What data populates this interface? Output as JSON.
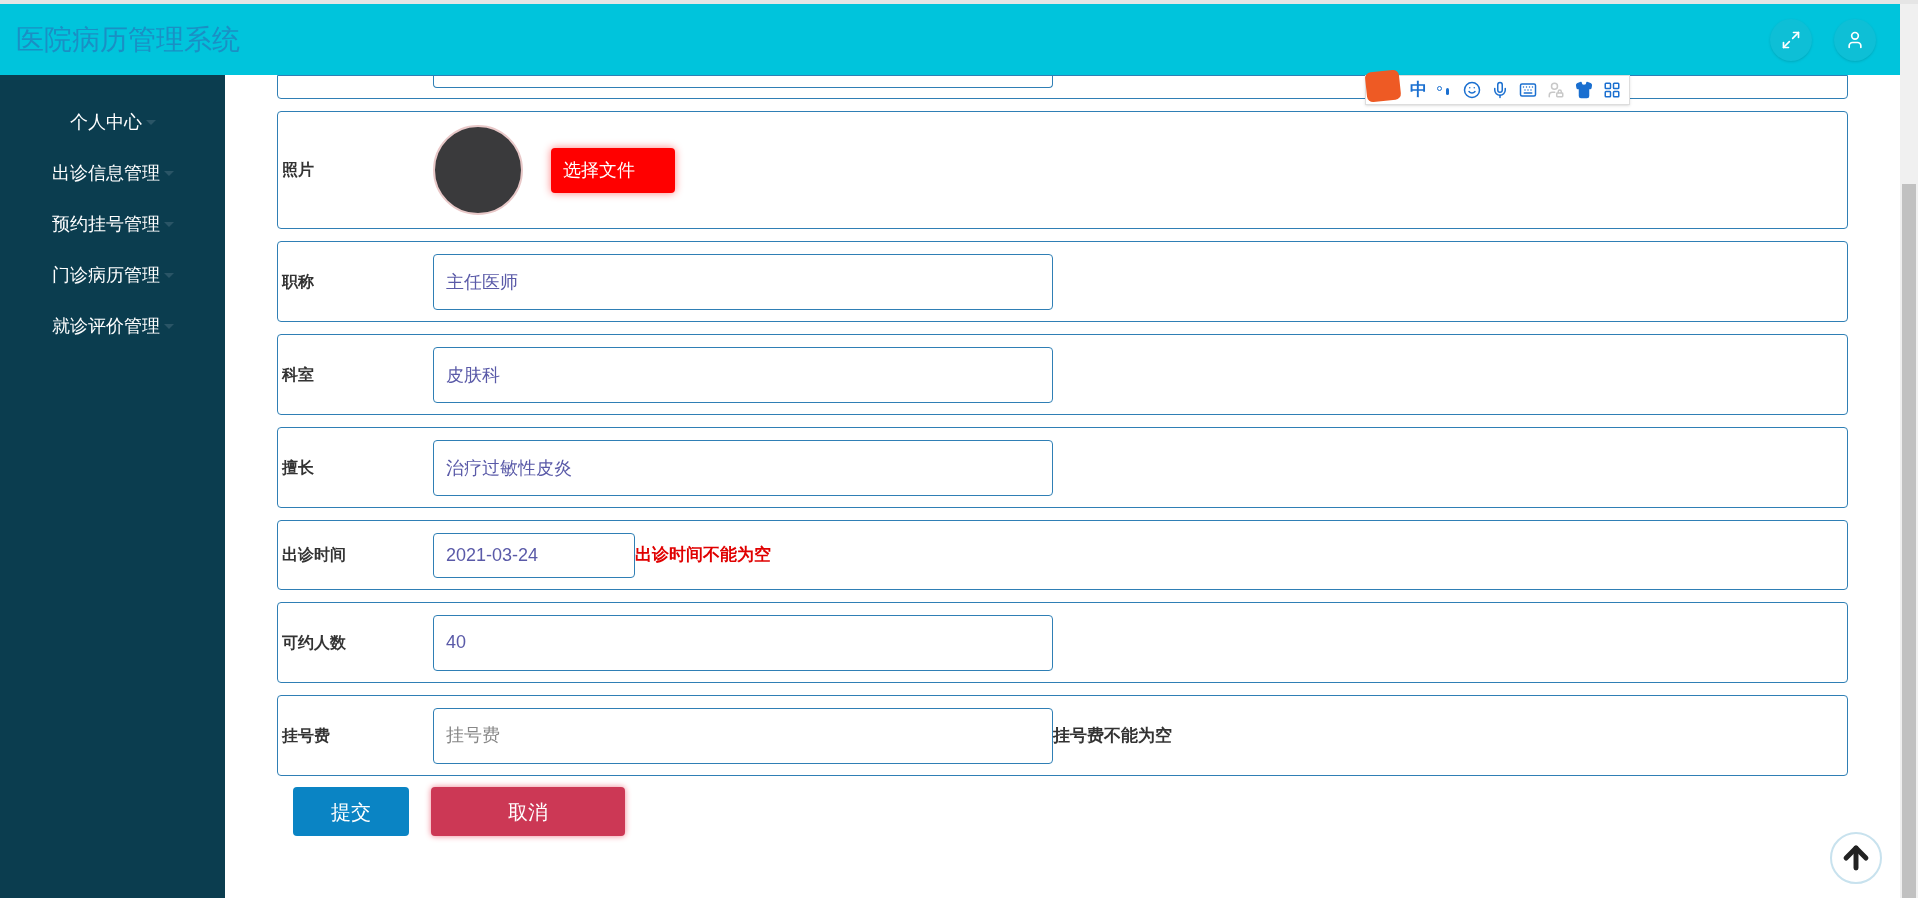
{
  "header": {
    "title": "医院病历管理系统"
  },
  "sidebar": {
    "items": [
      {
        "label": "个人中心"
      },
      {
        "label": "出诊信息管理"
      },
      {
        "label": "预约挂号管理"
      },
      {
        "label": "门诊病历管理"
      },
      {
        "label": "就诊评价管理"
      }
    ]
  },
  "ime_toolbar": {
    "mode": "中"
  },
  "form": {
    "fields": [
      {
        "kind": "partial"
      },
      {
        "kind": "photo",
        "label": "照片",
        "button": "选择文件"
      },
      {
        "kind": "text",
        "label": "职称",
        "value": "主任医师"
      },
      {
        "kind": "text",
        "label": "科室",
        "value": "皮肤科"
      },
      {
        "kind": "text",
        "label": "擅长",
        "value": "治疗过敏性皮炎"
      },
      {
        "kind": "date",
        "label": "出诊时间",
        "value": "2021-03-24",
        "error": "出诊时间不能为空",
        "color": "#e00000"
      },
      {
        "kind": "text",
        "label": "可约人数",
        "value": "40"
      },
      {
        "kind": "text",
        "label": "挂号费",
        "placeholder": "挂号费",
        "error": "挂号费不能为空",
        "color": "#333333"
      }
    ],
    "buttons": [
      {
        "label": "提交",
        "kind": "primary"
      },
      {
        "label": "取消",
        "kind": "danger"
      }
    ]
  }
}
